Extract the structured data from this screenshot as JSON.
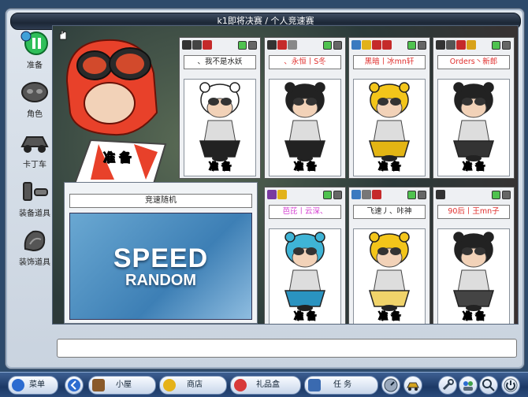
{
  "window": {
    "title": "k1即将决赛 / 个人竞速赛"
  },
  "sidebar": {
    "items": [
      {
        "label": "准备",
        "icon": "ready-icon"
      },
      {
        "label": "角色",
        "icon": "character-icon"
      },
      {
        "label": "卡丁车",
        "icon": "kart-icon"
      },
      {
        "label": "装备道具",
        "icon": "equipment-icon"
      },
      {
        "label": "装饰道具",
        "icon": "decoration-icon"
      }
    ]
  },
  "self": {
    "ready_label": "准 备"
  },
  "track": {
    "name": "竞速随机",
    "line1": "SPEED",
    "line2": "RANDOM"
  },
  "slots": [
    {
      "name": "、我不是水妖",
      "status": "准 备",
      "name_color": "#222222",
      "hair": "#ffffff",
      "bike": "#222222"
    },
    {
      "name": "、永恒丨S冬",
      "status": "准 备",
      "name_color": "#e0302e",
      "hair": "#222222",
      "bike": "#222222"
    },
    {
      "name": "黑暗丨冰mn轩",
      "status": "准 备",
      "name_color": "#e0302e",
      "hair": "#f3c51a",
      "bike": "#e3b514"
    },
    {
      "name": "Orders丶新郎",
      "status": "准 备",
      "name_color": "#e0302e",
      "hair": "#222222",
      "bike": "#333333"
    },
    {
      "name": "芭芘丨云深、",
      "status": "准 备",
      "name_color": "#d33ad0",
      "hair": "#3fb4d6",
      "bike": "#2a93c0"
    },
    {
      "name": "飞速丿、咔神",
      "status": "准 备",
      "name_color": "#222222",
      "hair": "#f3c51a",
      "bike": "#f0d36a"
    },
    {
      "name": "90后丨王mn子",
      "status": "准 备",
      "name_color": "#e0302e",
      "hair": "#222222",
      "bike": "#444444"
    }
  ],
  "taskbar": {
    "menu": "菜单",
    "home": "小屋",
    "shop": "商店",
    "gift": "礼品盒",
    "task": "任  务"
  },
  "colors": {
    "accent": "#1d3a66",
    "ready_green": "#4fc24f",
    "name_red": "#e0302e"
  }
}
